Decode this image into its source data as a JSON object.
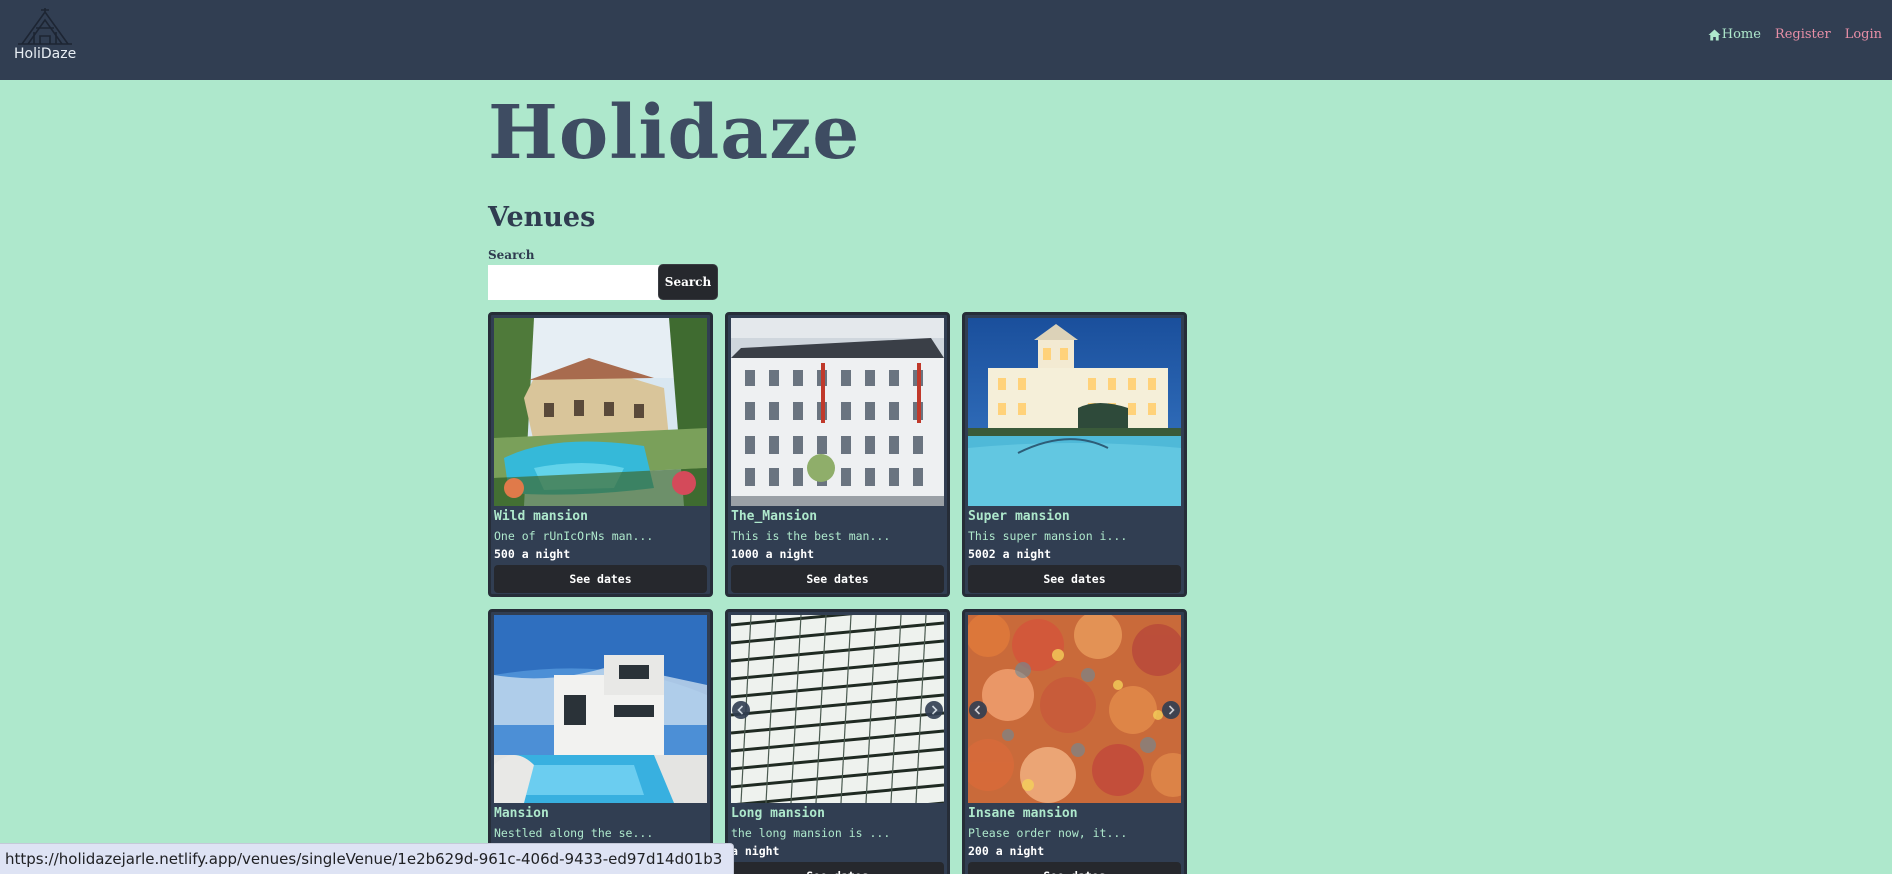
{
  "header": {
    "logo_text": "HoliDaze",
    "nav": {
      "home": "Home",
      "register": "Register",
      "login": "Login"
    }
  },
  "main": {
    "site_title": "Holidaze",
    "section_title": "Venues",
    "search": {
      "label": "Search",
      "value": "",
      "button": "Search"
    }
  },
  "venues": [
    {
      "name": "Wild mansion",
      "desc": "One of rUnIcOrNs man...",
      "price": "500 a night",
      "button": "See dates",
      "image": "villa-pool-photo"
    },
    {
      "name": "The_Mansion",
      "desc": "This is the best man...",
      "price": "1000 a night",
      "button": "See dates",
      "image": "white-building-photo"
    },
    {
      "name": "Super mansion",
      "desc": "This super mansion i...",
      "price": "5002 a night",
      "button": "See dates",
      "image": "night-mansion-photo"
    },
    {
      "name": "Mansion",
      "desc": "Nestled along the se...",
      "price": "",
      "button": "",
      "image": "modern-house-photo"
    },
    {
      "name": "Long mansion",
      "desc": "the long mansion is ...",
      "price": "a night",
      "button": "See dates",
      "image": "glass-facade-photo"
    },
    {
      "name": "Insane mansion",
      "desc": "Please order now, it...",
      "price": "200 a night",
      "button": "See dates",
      "image": "flowers-photo"
    }
  ],
  "status_bar": {
    "url": "https://holidazejarle.netlify.app/venues/singleVenue/1e2b629d-961c-406d-9433-ed97d14d01b3"
  },
  "colors": {
    "background": "#aee8cc",
    "navbar": "#313e52",
    "card": "#313e52",
    "button": "#26282d",
    "accent_mint": "#aee8cc",
    "accent_pink": "#e88fa7",
    "title": "#3e4c62"
  }
}
